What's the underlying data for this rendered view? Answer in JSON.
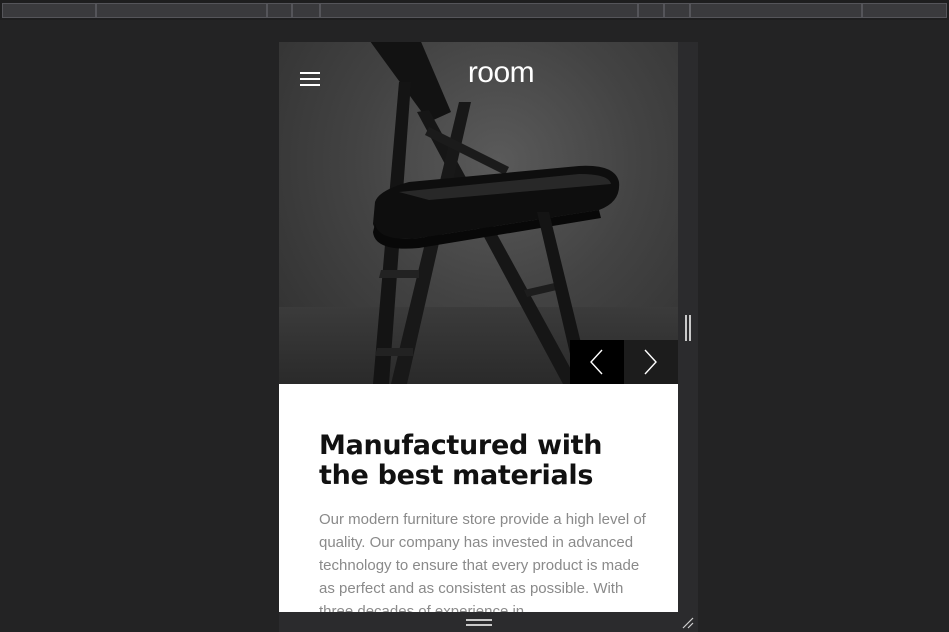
{
  "header": {
    "logo_text": "room",
    "menu_icon": "hamburger-icon"
  },
  "hero": {
    "image": "black folding chair photo",
    "prev_icon": "chevron-left-icon",
    "next_icon": "chevron-right-icon"
  },
  "content": {
    "headline_line1": "Manufactured with",
    "headline_line2": "the best materials",
    "body_text": "Our modern furniture store provide a high level of quality. Our company has invested in advanced technology to ensure that every product is made as perfect and as consistent as possible. With three decades of experience in"
  },
  "colors": {
    "background": "#232324",
    "headline": "#111111",
    "body_text": "#8a8a8a",
    "prev_button": "#000000",
    "next_button": "#1c1c1c"
  }
}
